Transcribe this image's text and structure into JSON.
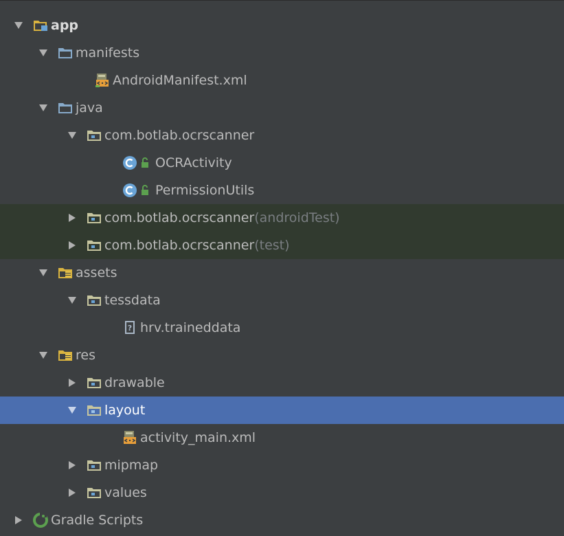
{
  "tree": {
    "rows": [
      {
        "label": "app",
        "suffix": "",
        "icon": "module-folder-icon",
        "expanded": true
      },
      {
        "label": "manifests",
        "suffix": "",
        "icon": "folder-icon",
        "expanded": true
      },
      {
        "label": "AndroidManifest.xml",
        "suffix": "",
        "icon": "manifest-file-icon"
      },
      {
        "label": "java",
        "suffix": "",
        "icon": "source-folder-icon",
        "expanded": true
      },
      {
        "label": "com.botlab.ocrscanner",
        "suffix": "",
        "icon": "package-icon",
        "expanded": true
      },
      {
        "label": "OCRActivity",
        "suffix": "",
        "icon": "class-icon"
      },
      {
        "label": "PermissionUtils",
        "suffix": "",
        "icon": "class-icon"
      },
      {
        "label": "com.botlab.ocrscanner",
        "suffix": " (androidTest)",
        "icon": "package-icon",
        "expanded": false
      },
      {
        "label": "com.botlab.ocrscanner",
        "suffix": " (test)",
        "icon": "package-icon",
        "expanded": false
      },
      {
        "label": "assets",
        "suffix": "",
        "icon": "resource-folder-icon",
        "expanded": true
      },
      {
        "label": "tessdata",
        "suffix": "",
        "icon": "package-icon",
        "expanded": true
      },
      {
        "label": "hrv.traineddata",
        "suffix": "",
        "icon": "unknown-file-icon"
      },
      {
        "label": "res",
        "suffix": "",
        "icon": "resource-folder-icon",
        "expanded": true
      },
      {
        "label": "drawable",
        "suffix": "",
        "icon": "package-icon",
        "expanded": false
      },
      {
        "label": "layout",
        "suffix": "",
        "icon": "package-icon",
        "expanded": true,
        "selected": true
      },
      {
        "label": "activity_main.xml",
        "suffix": "",
        "icon": "xml-file-icon"
      },
      {
        "label": "mipmap",
        "suffix": "",
        "icon": "package-icon",
        "expanded": false
      },
      {
        "label": "values",
        "suffix": "",
        "icon": "package-icon",
        "expanded": false
      },
      {
        "label": "Gradle Scripts",
        "suffix": "",
        "icon": "gradle-icon",
        "expanded": false
      }
    ]
  },
  "colors": {
    "background": "#3c3f41",
    "selection": "#4b6eaf",
    "test_row_background": "#313a2f",
    "text": "#bbbbbb",
    "suffix_text": "#7a7e82",
    "folder_blue": "#87aaca",
    "package_olive": "#c6c59f",
    "class_blue": "#6aa4d6",
    "lock_green": "#5ca04f"
  }
}
